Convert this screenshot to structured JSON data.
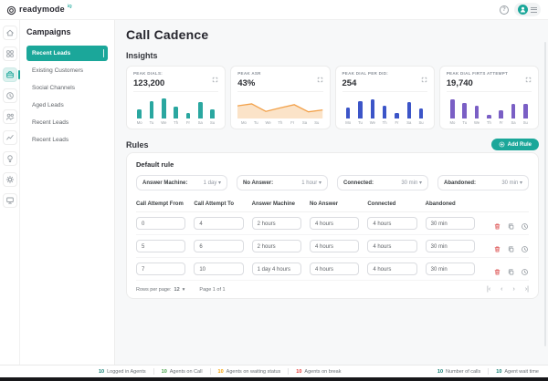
{
  "brand": {
    "name": "readymode",
    "superscript": "iQ"
  },
  "icon_rail": {
    "items": [
      {
        "name": "home",
        "active": false
      },
      {
        "name": "campaigns",
        "active": false
      },
      {
        "name": "dialer",
        "active": true
      },
      {
        "name": "schedule",
        "active": false
      },
      {
        "name": "contacts",
        "active": false
      },
      {
        "name": "reports",
        "active": false
      },
      {
        "name": "insights",
        "active": false
      },
      {
        "name": "settings",
        "active": false
      },
      {
        "name": "workstation",
        "active": false
      }
    ]
  },
  "sidebar": {
    "title": "Campaigns",
    "items": [
      {
        "label": "Recent Leads",
        "selected": true
      },
      {
        "label": "Existing Customers",
        "selected": false
      },
      {
        "label": "Social Channels",
        "selected": false
      },
      {
        "label": "Aged Leads",
        "selected": false
      },
      {
        "label": "Recent Leads",
        "selected": false
      },
      {
        "label": "Recent Leads",
        "selected": false
      }
    ]
  },
  "main": {
    "title": "Call Cadence",
    "insights_label": "Insights",
    "rules_label": "Rules",
    "add_rule_label": "Add Rule"
  },
  "chart_data": [
    {
      "type": "bar",
      "title": "PEAK DIALS:",
      "value": "123,200",
      "categories": [
        "Mo",
        "Tu",
        "We",
        "Th",
        "Fr",
        "Sa",
        "Su"
      ],
      "values": [
        40,
        75,
        85,
        50,
        25,
        70,
        40
      ],
      "color": "#2aa7a0",
      "ylim": [
        0,
        100
      ],
      "legend": "none",
      "grid": false
    },
    {
      "type": "area",
      "title": "PEAK ASR",
      "value": "43%",
      "categories": [
        "Mo",
        "Tu",
        "We",
        "Th",
        "Fr",
        "Sa",
        "Su"
      ],
      "values": [
        62,
        72,
        35,
        52,
        68,
        33,
        42
      ],
      "color": "#f2a14a",
      "ylim": [
        0,
        100
      ],
      "legend": "none",
      "grid": false
    },
    {
      "type": "bar",
      "title": "PEAK DIAL PER DID:",
      "value": "254",
      "categories": [
        "Mo",
        "Tu",
        "We",
        "Th",
        "Fr",
        "Sa",
        "Su"
      ],
      "values": [
        45,
        72,
        82,
        52,
        22,
        68,
        42
      ],
      "color": "#3c55c8",
      "ylim": [
        0,
        100
      ],
      "legend": "none",
      "grid": false
    },
    {
      "type": "bar",
      "title": "PEAK DIAL FIRTS ATTEMPT",
      "value": "19,740",
      "categories": [
        "Mo",
        "Tu",
        "We",
        "Th",
        "Fr",
        "Sa",
        "Su"
      ],
      "values": [
        80,
        65,
        55,
        15,
        35,
        60,
        62
      ],
      "color": "#7a5fc5",
      "ylim": [
        0,
        100
      ],
      "legend": "none",
      "grid": false
    }
  ],
  "default_rule": {
    "title": "Default rule",
    "fields": [
      {
        "label": "Answer Machine:",
        "value": "1 day"
      },
      {
        "label": "No Answer:",
        "value": "1 hour"
      },
      {
        "label": "Connected:",
        "value": "30 min"
      },
      {
        "label": "Abandoned:",
        "value": "30 min"
      }
    ]
  },
  "table": {
    "columns": [
      "Call Attempt From",
      "Call Attempt To",
      "Answer Machine",
      "No Answer",
      "Connected",
      "Abandoned"
    ],
    "rows": [
      [
        "0",
        "4",
        "2 hours",
        "4 hours",
        "4 hours",
        "30 min"
      ],
      [
        "5",
        "6",
        "2 hours",
        "4 hours",
        "4 hours",
        "30 min"
      ],
      [
        "7",
        "10",
        "1 day 4 hours",
        "4 hours",
        "4 hours",
        "30 min"
      ]
    ],
    "row_actions": [
      "delete-icon",
      "duplicate-icon",
      "schedule-icon"
    ]
  },
  "pagination": {
    "rows_per_page_label": "Rows per page:",
    "rows_per_page": "12",
    "page_info": "Page 1 of 1"
  },
  "statusbar": {
    "left_items": [
      {
        "value": "10",
        "label": "Logged in Agents",
        "color": "#0e7c72"
      },
      {
        "value": "10",
        "label": "Agents on Call",
        "color": "#43a047"
      },
      {
        "value": "10",
        "label": "Agents on waiting status",
        "color": "#f59f00"
      },
      {
        "value": "10",
        "label": "Agents on break",
        "color": "#e53935"
      }
    ],
    "right_items": [
      {
        "value": "10",
        "label": "Number of calls",
        "color": "#0e7c72"
      },
      {
        "value": "10",
        "label": "Agent wait time",
        "color": "#0e7c72"
      }
    ]
  }
}
